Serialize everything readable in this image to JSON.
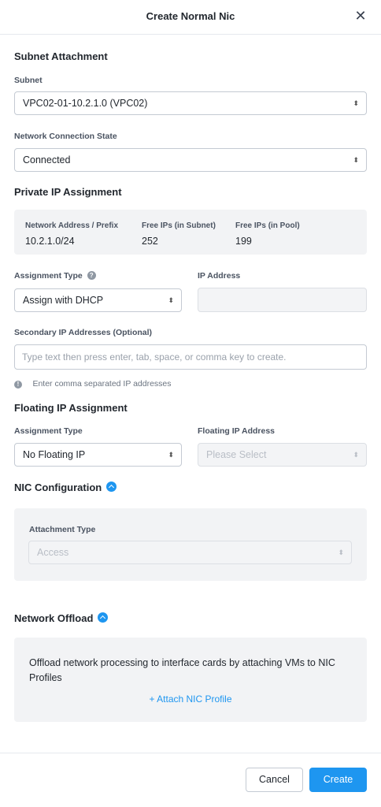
{
  "dialog": {
    "title": "Create Normal Nic",
    "close_icon": "close-icon"
  },
  "subnet_attachment": {
    "heading": "Subnet Attachment",
    "subnet_label": "Subnet",
    "subnet_value": "VPC02-01-10.2.1.0 (VPC02)",
    "connection_label": "Network Connection State",
    "connection_value": "Connected"
  },
  "private_ip": {
    "heading": "Private IP Assignment",
    "stats": [
      {
        "label": "Network Address / Prefix",
        "value": "10.2.1.0/24"
      },
      {
        "label": "Free IPs (in Subnet)",
        "value": "252"
      },
      {
        "label": "Free IPs (in Pool)",
        "value": "199"
      }
    ],
    "assignment_type_label": "Assignment Type",
    "assignment_type_value": "Assign with DHCP",
    "ip_address_label": "IP Address",
    "ip_address_value": "",
    "secondary_label": "Secondary IP Addresses (Optional)",
    "secondary_placeholder": "Type text then press enter, tab, space, or comma key to create.",
    "secondary_hint": "Enter comma separated IP addresses"
  },
  "floating_ip": {
    "heading": "Floating IP Assignment",
    "assignment_type_label": "Assignment Type",
    "assignment_type_value": "No Floating IP",
    "floating_address_label": "Floating IP Address",
    "floating_address_placeholder": "Please Select"
  },
  "nic_configuration": {
    "heading": "NIC Configuration",
    "attachment_type_label": "Attachment Type",
    "attachment_type_value": "Access"
  },
  "network_offload": {
    "heading": "Network Offload",
    "description": "Offload network processing to interface cards by attaching VMs to NIC Profiles",
    "attach_link": "+ Attach NIC Profile"
  },
  "footer": {
    "cancel_label": "Cancel",
    "create_label": "Create"
  },
  "colors": {
    "accent": "#1e96f0",
    "panel": "#f2f3f5",
    "border": "#c4cad3"
  }
}
